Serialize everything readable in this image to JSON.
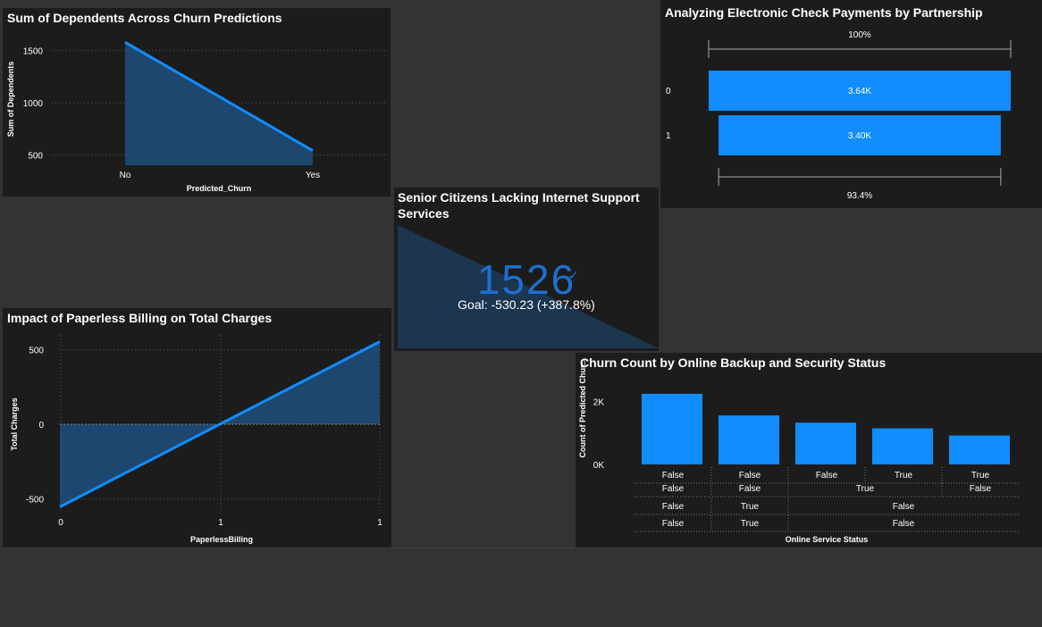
{
  "panels": {
    "dependents": {
      "title": "Sum of Dependents Across Churn Predictions"
    },
    "electronic_check": {
      "title": "Analyzing Electronic Check Payments by Partnership"
    },
    "senior": {
      "title_line1": "Senior Citizens Lacking Internet Support",
      "title_line2": "Services"
    },
    "paperless": {
      "title": "Impact of Paperless Billing on Total Charges"
    },
    "online": {
      "title": "Churn Count by Online Backup and Security Status"
    }
  },
  "kpi": {
    "value": "1526",
    "goal_text": "Goal: -530.23 (+387.8%)",
    "check_icon": "checkmark-icon"
  },
  "colors": {
    "accent": "#118dff",
    "fill": "#1d4f7e",
    "panel": "#1c1c1c",
    "canvas": "#333333",
    "kpi": "#1e6fd0"
  },
  "chart_data": [
    {
      "type": "area",
      "title": "Sum of Dependents Across Churn Predictions",
      "xlabel": "Predicted_Churn",
      "ylabel": "Sum of Dependents",
      "categories": [
        "No",
        "Yes"
      ],
      "values": [
        1580,
        540
      ],
      "ylim": [
        400,
        1600
      ],
      "yticks": [
        500,
        1000,
        1500
      ],
      "grid": true
    },
    {
      "type": "bar",
      "title": "Analyzing Electronic Check Payments by Partnership",
      "orientation": "horizontal",
      "categories": [
        "0",
        "1"
      ],
      "values": [
        3640,
        3400
      ],
      "data_labels": [
        "3.64K",
        "3.40K"
      ],
      "top_label": "100%",
      "bottom_label": "93.4%"
    },
    {
      "type": "area",
      "title": "Impact of Paperless Billing on Total Charges",
      "xlabel": "PaperlessBilling",
      "ylabel": "Total Charges",
      "x": [
        0,
        1
      ],
      "values": [
        -555,
        555
      ],
      "xticks": [
        "0",
        "1",
        "1"
      ],
      "yticks": [
        500,
        0,
        -500
      ],
      "ylim": [
        -600,
        600
      ],
      "grid": true
    },
    {
      "type": "bar",
      "title": "Churn Count by Online Backup and Security Status",
      "xlabel": "Online Service Status",
      "ylabel": "Count of Predicted Chur...",
      "values": [
        2250,
        1560,
        1330,
        1150,
        920
      ],
      "ylim": [
        0,
        2700
      ],
      "yticks": [
        "0K",
        "2K"
      ],
      "hierarchy_rows": [
        [
          {
            "label": "False",
            "span": 1
          },
          {
            "label": "False",
            "span": 1
          },
          {
            "label": "False",
            "span": 1
          },
          {
            "label": "True",
            "span": 1
          },
          {
            "label": "True",
            "span": 1
          }
        ],
        [
          {
            "label": "False",
            "span": 1
          },
          {
            "label": "False",
            "span": 1
          },
          {
            "label": "True",
            "span": 2
          },
          {
            "label": "False",
            "span": 1
          }
        ],
        [
          {
            "label": "False",
            "span": 1
          },
          {
            "label": "True",
            "span": 1
          },
          {
            "label": "False",
            "span": 3
          }
        ],
        [
          {
            "label": "False",
            "span": 1
          },
          {
            "label": "True",
            "span": 1
          },
          {
            "label": "False",
            "span": 3
          }
        ]
      ]
    }
  ]
}
